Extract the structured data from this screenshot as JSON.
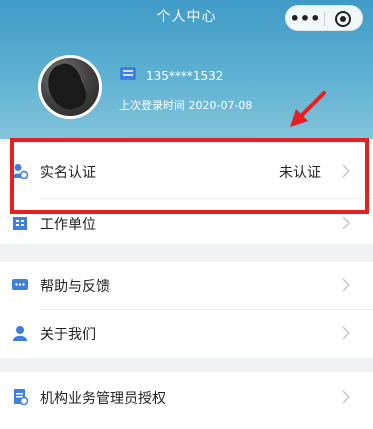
{
  "header": {
    "title": "个人中心",
    "capsule_more": "•••"
  },
  "profile": {
    "phone": "135****1532",
    "last_login": "上次登录时间 2020-07-08"
  },
  "menu": {
    "real_name": {
      "label": "实名认证",
      "value": "未认证",
      "icon": "person-verify-icon"
    },
    "work_unit": {
      "label": "工作单位",
      "icon": "building-icon"
    },
    "help": {
      "label": "帮助与反馈",
      "icon": "chat-icon"
    },
    "about": {
      "label": "关于我们",
      "icon": "person-icon"
    },
    "org_auth": {
      "label": "机构业务管理员授权",
      "icon": "document-icon"
    }
  },
  "colors": {
    "header_top": "#3f9bc7",
    "highlight": "#e62020",
    "icon_blue": "#3f7fe0"
  }
}
